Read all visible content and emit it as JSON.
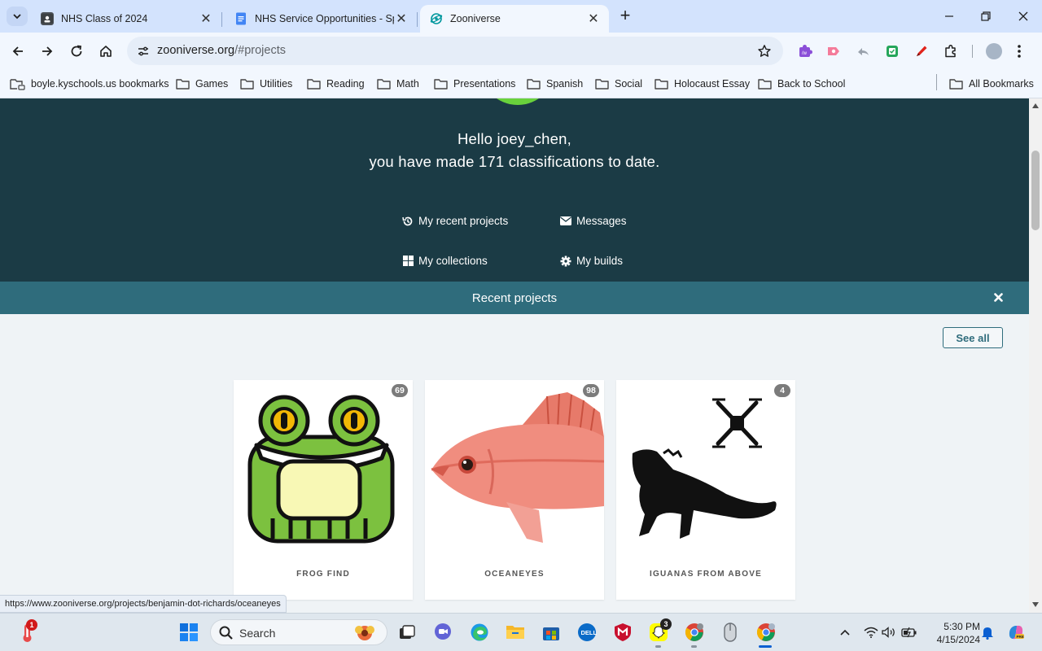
{
  "browser": {
    "tabs": [
      {
        "title": "NHS Class of 2024",
        "active": false
      },
      {
        "title": "NHS Service Opportunities - Sp",
        "active": false
      },
      {
        "title": "Zooniverse",
        "active": true
      }
    ],
    "address": {
      "host": "zooniverse.org",
      "path": "/#projects"
    },
    "bookmarks": [
      "boyle.kyschools.us bookmarks",
      "Games",
      "Utilities",
      "Reading",
      "Math",
      "Presentations",
      "Spanish",
      "Social",
      "Holocaust Essay",
      "Back to School"
    ],
    "all_bookmarks": "All Bookmarks"
  },
  "hero": {
    "greeting": "Hello joey_chen,",
    "classifications": "you have made 171 classifications to date.",
    "links": {
      "recent": "My recent projects",
      "messages": "Messages",
      "collections": "My collections",
      "builds": "My builds"
    },
    "avatar_color": "#69d23c"
  },
  "recent": {
    "title": "Recent projects",
    "see_all": "See all",
    "projects": [
      {
        "name": "FROG FIND",
        "count": "69"
      },
      {
        "name": "OCEANEYES",
        "count": "98"
      },
      {
        "name": "IGUANAS FROM ABOVE",
        "count": "4"
      }
    ]
  },
  "status_url": "https://www.zooniverse.org/projects/benjamin-dot-richards/oceaneyes",
  "taskbar": {
    "search_label": "Search",
    "badges": {
      "weather": "1",
      "snapchat": "3"
    },
    "time": "5:30 PM",
    "date": "4/15/2024"
  },
  "colors": {
    "hero_bg": "#1b3b45",
    "recent_bar": "#2f6c7c",
    "page_bg": "#eff3f6"
  }
}
